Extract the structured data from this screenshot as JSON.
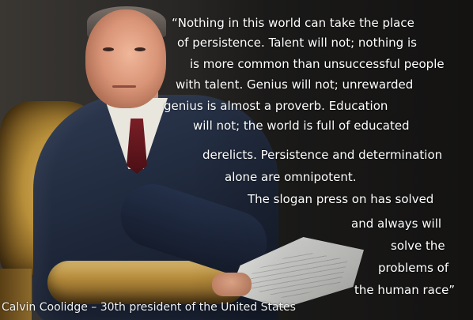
{
  "quote": {
    "lines": [
      "“Nothing in this world can take the place",
      "of persistence. Talent will not; nothing is",
      "is more common than unsuccessful people",
      "with talent. Genius will not; unrewarded",
      "genius is almost a proverb. Education",
      "will not; the world is full of educated",
      "derelicts. Persistence and determination",
      "alone are omnipotent.",
      "The slogan press on has solved",
      "and always will",
      "solve the",
      "problems of",
      "the human race”"
    ]
  },
  "attribution": "Calvin Coolidge – 30th president of the United States",
  "colors": {
    "text": "#ffffff",
    "background": "#1f1e1d",
    "chair_gold": "#b88f3a",
    "suit_navy": "#1d2638"
  }
}
